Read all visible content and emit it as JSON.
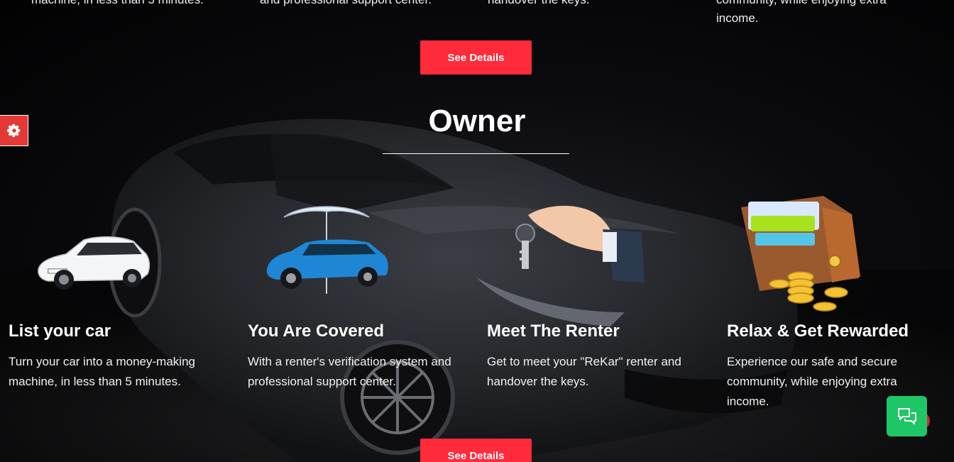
{
  "top_row": {
    "texts": [
      "machine, in less than 5 minutes.",
      "and professional support center.",
      "handover the keys.",
      "community, while enjoying extra",
      "income."
    ],
    "button_label": "See Details"
  },
  "section": {
    "title": "Owner",
    "button_label": "See Details"
  },
  "features": [
    {
      "title": "List your car",
      "desc": "Turn your car into a money-making machine, in less than 5 minutes.",
      "icon": "white-sedan-icon"
    },
    {
      "title": "You Are Covered",
      "desc": "With a renter's verification system and professional support center.",
      "icon": "car-umbrella-icon"
    },
    {
      "title": "Meet The Renter",
      "desc": "Get to meet your \"ReKar\" renter and handover the keys.",
      "icon": "hand-key-icon"
    },
    {
      "title": "Relax & Get Rewarded",
      "desc": "Experience our safe and secure community, while enjoying extra income.",
      "icon": "wallet-coins-icon"
    }
  ],
  "widgets": {
    "settings_icon": "gear-icon",
    "chat_icon": "chat-icon"
  },
  "colors": {
    "accent": "#ff2a3a",
    "settings_tab": "#e53935",
    "chat": "#1fc666"
  }
}
